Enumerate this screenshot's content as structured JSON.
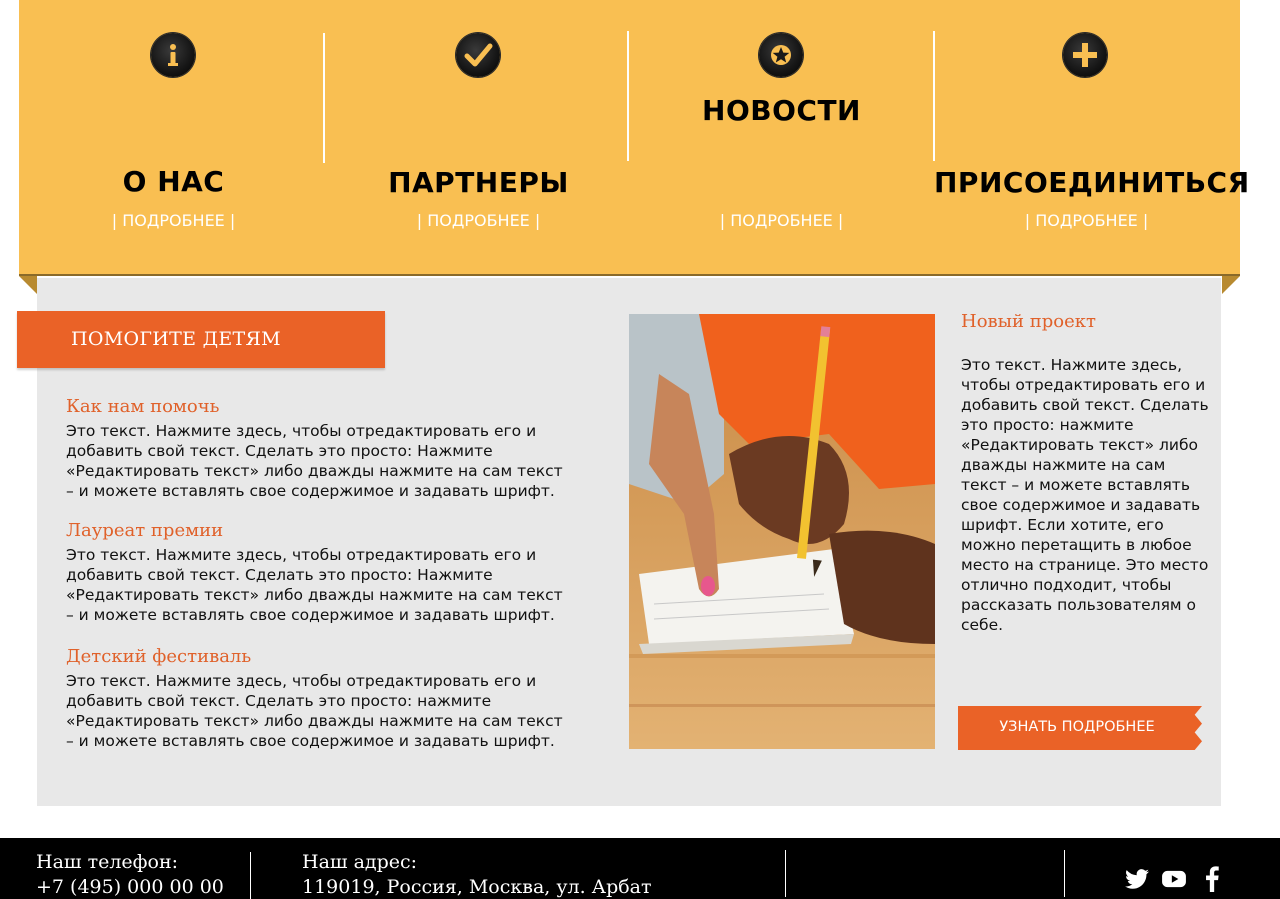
{
  "features": [
    {
      "title": "О НАС",
      "more": "| ПОДРОБНЕЕ |",
      "icon": "info-icon"
    },
    {
      "title": "ПАРТНЕРЫ",
      "more": "| ПОДРОБНЕЕ |",
      "icon": "check-icon"
    },
    {
      "title": "НОВОСТИ",
      "more": "| ПОДРОБНЕЕ |",
      "icon": "star-icon"
    },
    {
      "title": "ПРИСОЕДИНИТЬСЯ",
      "more": "| ПОДРОБНЕЕ |",
      "icon": "plus-icon"
    }
  ],
  "help_banner": {
    "label": "ПОМОГИТЕ ДЕТЯМ"
  },
  "articles": [
    {
      "title": "Как нам помочь",
      "text": "Это текст. Нажмите здесь, чтобы отредактировать его и добавить свой текст. Сделать это просто: Нажмите «Редактировать текст» либо дважды нажмите на сам текст – и можете вставлять свое содержимое и задавать шрифт."
    },
    {
      "title": "Лауреат премии",
      "text": "Это текст. Нажмите здесь, чтобы отредактировать его и добавить свой текст. Сделать это просто: Нажмите «Редактировать текст» либо дважды нажмите на сам текст – и можете вставлять свое содержимое и задавать шрифт."
    },
    {
      "title": "Детский фестиваль",
      "text": "Это текст. Нажмите здесь, чтобы отредактировать его и добавить свой текст. Сделать это просто: нажмите «Редактировать текст» либо дважды нажмите на сам текст – и можете вставлять свое содержимое и задавать шрифт."
    }
  ],
  "project": {
    "title": "Новый проект",
    "text": "Это текст. Нажмите здесь, чтобы отредактировать его и добавить свой текст. Сделать это просто: нажмите «Редактировать текст» либо дважды нажмите на сам текст – и можете вставлять свое содержимое и задавать шрифт. Если хотите, его можно перетащить в любое место на странице. Это место отлично подходит, чтобы рассказать пользователям о себе.",
    "button": "УЗНАТЬ ПОДРОБНЕЕ"
  },
  "footer": {
    "phone_label": "Наш телефон:",
    "phone": "+7 (495) 000 00 00",
    "address_label": "Наш адрес:",
    "address": "119019, Россия, Москва, ул. Арбат"
  },
  "social": [
    "twitter-icon",
    "youtube-icon",
    "facebook-icon"
  ],
  "colors": {
    "accent": "#ea6227",
    "band": "#f9bf52",
    "panel": "#e8e8e8",
    "footer": "#000000"
  }
}
